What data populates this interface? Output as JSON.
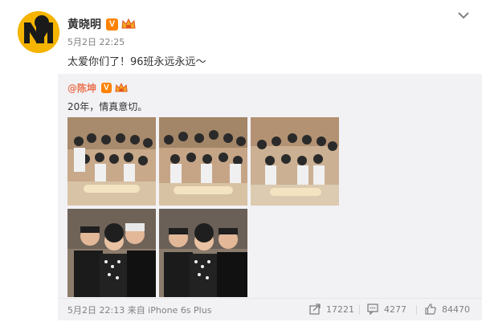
{
  "post": {
    "user_name": "黄晓明",
    "verified_badge": "V",
    "time": "5月2日 22:25",
    "text": "太爱你们了！96班永远永远～",
    "icons": [
      "avatar-logo",
      "verified-icon",
      "crown-icon",
      "chevron-down-icon"
    ]
  },
  "repost": {
    "mention": "@陈坤",
    "verified_badge": "V",
    "text": "20年，情真意切。",
    "photos": [
      {
        "name": "group-photo-1"
      },
      {
        "name": "group-photo-2"
      },
      {
        "name": "group-photo-3"
      },
      {
        "name": "trio-photo-1"
      },
      {
        "name": "trio-photo-2"
      }
    ],
    "footer": {
      "time_source": "5月2日 22:13 来自 iPhone 6s Plus",
      "reposts": "17221",
      "comments": "4277",
      "likes": "84470"
    }
  },
  "colors": {
    "brand_orange": "#ff8200",
    "mention_color": "#eb7350",
    "repost_bg": "#f2f2f5",
    "avatar_yellow": "#f4b400"
  }
}
